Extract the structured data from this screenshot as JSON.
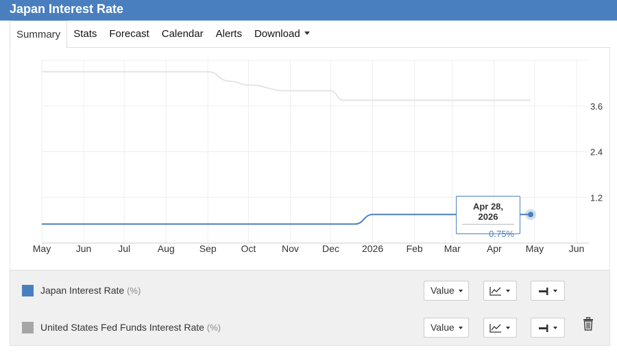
{
  "header": {
    "title": "Japan Interest Rate"
  },
  "tabs": [
    {
      "label": "Summary",
      "active": true
    },
    {
      "label": "Stats"
    },
    {
      "label": "Forecast"
    },
    {
      "label": "Calendar"
    },
    {
      "label": "Alerts"
    },
    {
      "label": "Download",
      "dropdown": true
    }
  ],
  "tooltip": {
    "date": "Apr 28, 2026",
    "value": "0.75%"
  },
  "legend": [
    {
      "name": "Japan Interest Rate",
      "unit": "(%)",
      "color": "#4a7fbf",
      "value_label": "Value",
      "type_icon": "line-chart-icon",
      "axis_icon": "axis-right-icon"
    },
    {
      "name": "United States Fed Funds Interest Rate",
      "unit": "(%)",
      "color": "#a6a6a6",
      "value_label": "Value",
      "type_icon": "line-chart-icon",
      "axis_icon": "axis-right-icon",
      "removable": true
    }
  ],
  "chart_data": {
    "type": "line",
    "x_tick_labels": [
      "May",
      "Jun",
      "Jul",
      "Aug",
      "Sep",
      "Oct",
      "Nov",
      "Dec",
      "2026",
      "Feb",
      "Mar",
      "Apr",
      "May",
      "Jun"
    ],
    "x_ticks": [
      "2025-05-01",
      "2025-06-01",
      "2025-07-01",
      "2025-08-01",
      "2025-09-01",
      "2025-10-01",
      "2025-11-01",
      "2025-12-01",
      "2026-01-01",
      "2026-02-01",
      "2026-03-01",
      "2026-04-01",
      "2026-05-01",
      "2026-06-01"
    ],
    "y_ticks": [
      1.2,
      2.4,
      3.6
    ],
    "ylim": [
      0,
      4.8
    ],
    "grid": true,
    "y_axis_side": "right",
    "series": [
      {
        "name": "Japan Interest Rate",
        "color": "#4a7fbf",
        "x": [
          "2025-05-01",
          "2025-12-19",
          "2026-01-01",
          "2026-04-28"
        ],
        "y": [
          0.5,
          0.5,
          0.75,
          0.75
        ]
      },
      {
        "name": "United States Fed Funds Interest Rate",
        "color": "#e4e4e4",
        "x": [
          "2025-05-01",
          "2025-09-01",
          "2025-09-17",
          "2025-10-01",
          "2025-10-29",
          "2025-11-01",
          "2025-12-01",
          "2025-12-10",
          "2025-12-20",
          "2026-04-28"
        ],
        "y": [
          4.5,
          4.5,
          4.25,
          4.15,
          4.0,
          4.0,
          4.0,
          3.75,
          3.75,
          3.75
        ]
      }
    ]
  }
}
